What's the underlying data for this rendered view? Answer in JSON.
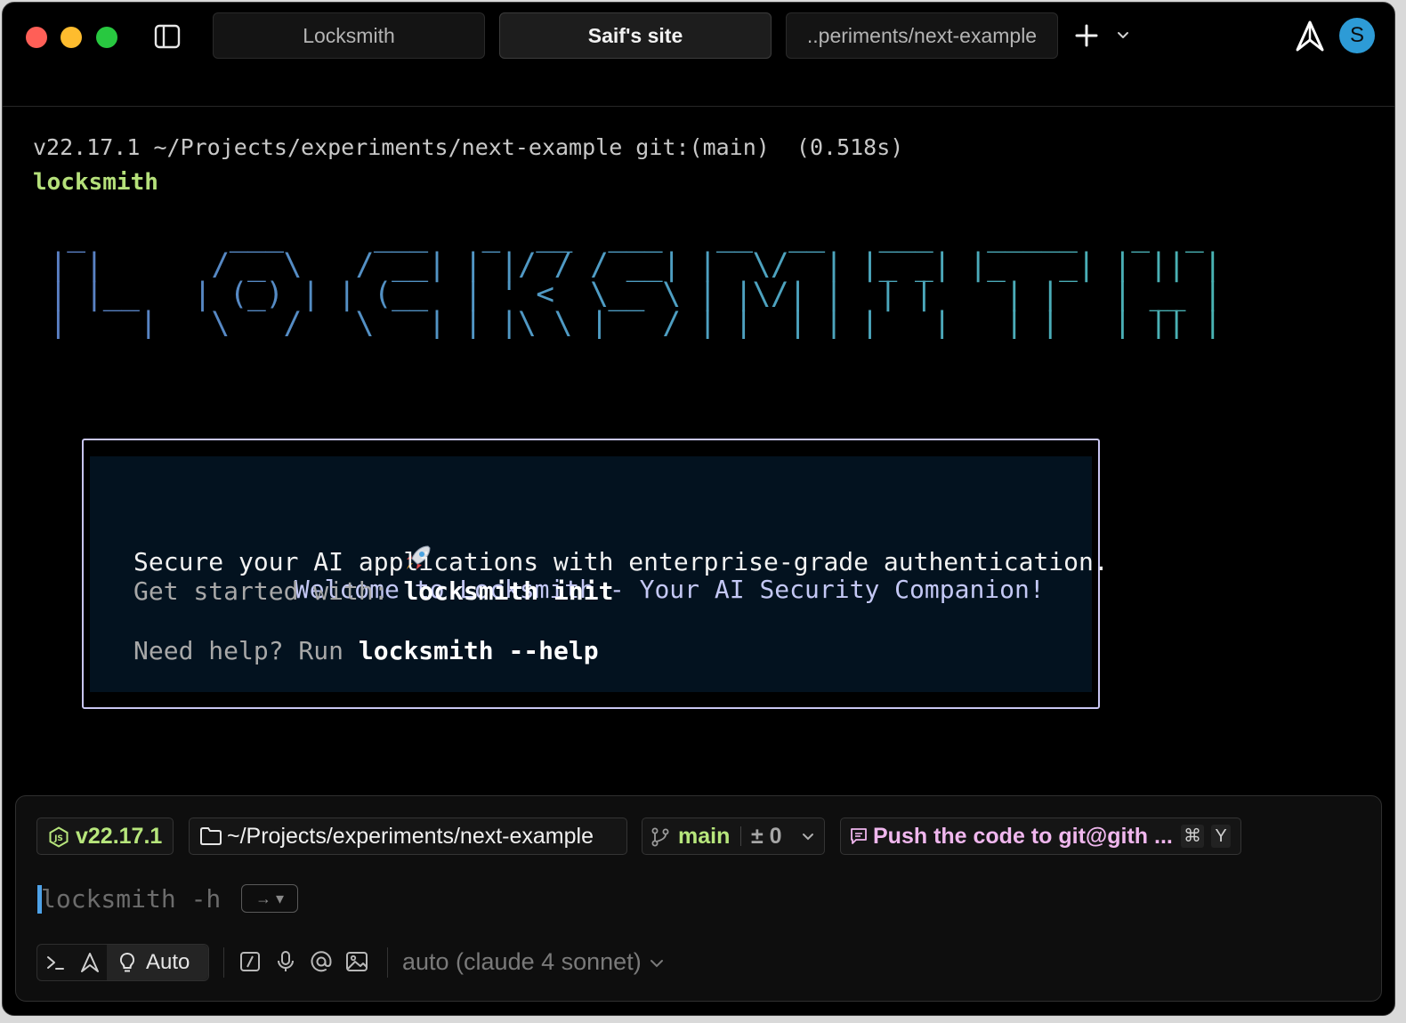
{
  "tabs": [
    {
      "label": "Locksmith",
      "active": false
    },
    {
      "label": "Saif's site",
      "active": true
    },
    {
      "label": "..periments/next-example",
      "active": false
    }
  ],
  "user": {
    "avatar_letter": "S",
    "avatar_color": "#2d9bd6"
  },
  "terminal": {
    "prompt_line": "v22.17.1 ~/Projects/experiments/next-example git:(main)  (0.518s)",
    "command": "locksmith",
    "ascii_banner": " _        ___     ___   _  __  ___   __  __   ___   _____   _  _ \n| |      / _ \\   / __| | |/ / / __| |  \\/  | |_ _| |_   _| | || |\n| |__   | (_) | | (__  | ' <  \\__ \\ | |\\/| |  | |    | |   | __ |\n|____|   \\___/   \\___| |_|\\_\\ |___/ |_|  |_| |___|   |_|   |_||_|",
    "welcome": {
      "title": "Welcome to Locksmith - Your AI Security Companion!",
      "secure": "Secure your AI applications with enterprise-grade authentication.",
      "started_prefix": "Get started with: ",
      "started_cmd": "locksmith init",
      "help_prefix": "Need help? Run ",
      "help_cmd": "locksmith --help"
    }
  },
  "context_chips": {
    "node_version": "v22.17.1",
    "directory": "~/Projects/experiments/next-example",
    "branch": "main",
    "diff": "± 0",
    "prompt_suggestion": "Push the code to git@gith ...",
    "shortcut_cmd": "⌘",
    "shortcut_key": "Y"
  },
  "input": {
    "placeholder": "locksmith -h",
    "accept_hint": "→ ▾"
  },
  "toolbar": {
    "mode_label": "Auto",
    "model": "auto (claude 4 sonnet)"
  },
  "colors": {
    "background": "#000000",
    "accent_green": "#b7e67c",
    "accent_pink": "#f0b7ee",
    "cursor_blue": "#4ea2e8",
    "welcome_border": "#c9c6f2"
  },
  "icons": [
    "sidebar-toggle-icon",
    "plus-icon",
    "chevron-down-icon",
    "warp-logo-icon",
    "nodejs-icon",
    "folder-icon",
    "git-branch-icon",
    "chat-bubble-icon",
    "terminal-icon",
    "agent-icon",
    "lightbulb-icon",
    "slash-command-icon",
    "microphone-icon",
    "at-icon",
    "image-icon",
    "rocket-icon"
  ]
}
